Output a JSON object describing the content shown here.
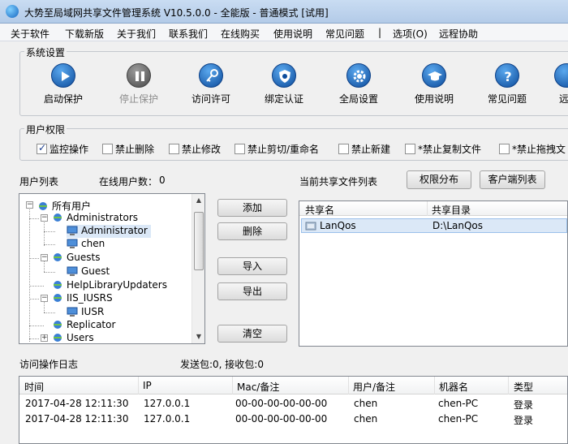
{
  "window": {
    "title": "大势至局域网共享文件管理系统 V10.5.0.0 - 全能版 - 普通模式 [试用]"
  },
  "menu": [
    "关于软件",
    "下载新版",
    "关于我们",
    "联系我们",
    "在线购买",
    "使用说明",
    "常见问题",
    "|",
    "选项(O)",
    "远程协助"
  ],
  "system_settings": {
    "label": "系统设置",
    "buttons": [
      {
        "label": "启动保护",
        "icon": "play-icon",
        "enabled": true
      },
      {
        "label": "停止保护",
        "icon": "pause-icon",
        "enabled": false
      },
      {
        "label": "访问许可",
        "icon": "key-icon",
        "enabled": true
      },
      {
        "label": "绑定认证",
        "icon": "shield-icon",
        "enabled": true
      },
      {
        "label": "全局设置",
        "icon": "gear-icon",
        "enabled": true
      },
      {
        "label": "使用说明",
        "icon": "graduation-cap-icon",
        "enabled": true
      },
      {
        "label": "常见问题",
        "icon": "question-icon",
        "enabled": true
      },
      {
        "label": "远",
        "icon": "more-icon",
        "enabled": true
      }
    ]
  },
  "user_permissions": {
    "label": "用户权限",
    "options": [
      {
        "label": "监控操作",
        "checked": true
      },
      {
        "label": "禁止删除",
        "checked": false
      },
      {
        "label": "禁止修改",
        "checked": false
      },
      {
        "label": "禁止剪切/重命名",
        "checked": false
      },
      {
        "label": "禁止新建",
        "checked": false
      },
      {
        "label": "*禁止复制文件",
        "checked": false
      },
      {
        "label": "*禁止拖拽文",
        "checked": false
      }
    ]
  },
  "users": {
    "label": "用户列表",
    "online_label": "在线用户数：",
    "online_count": "0",
    "tree": [
      {
        "label": "所有用户",
        "depth": 0,
        "expander": "−"
      },
      {
        "label": "Administrators",
        "depth": 1,
        "expander": "−"
      },
      {
        "label": "Administrator",
        "depth": 2,
        "expander": "",
        "selected": true
      },
      {
        "label": "chen",
        "depth": 2,
        "expander": ""
      },
      {
        "label": "Guests",
        "depth": 1,
        "expander": "−"
      },
      {
        "label": "Guest",
        "depth": 2,
        "expander": ""
      },
      {
        "label": "HelpLibraryUpdaters",
        "depth": 1,
        "expander": ""
      },
      {
        "label": "IIS_IUSRS",
        "depth": 1,
        "expander": "−"
      },
      {
        "label": "IUSR",
        "depth": 2,
        "expander": ""
      },
      {
        "label": "Replicator",
        "depth": 1,
        "expander": ""
      },
      {
        "label": "Users",
        "depth": 1,
        "expander": "+"
      }
    ]
  },
  "actions": {
    "add": "添加",
    "delete": "删除",
    "import": "导入",
    "export": "导出",
    "clear": "清空"
  },
  "shares": {
    "label": "当前共享文件列表",
    "perm_button": "权限分布",
    "client_button": "客户端列表",
    "columns": [
      "共享名",
      "共享目录"
    ],
    "rows": [
      {
        "name": "LanQos",
        "path": "D:\\LanQos"
      }
    ]
  },
  "log": {
    "label": "访问操作日志",
    "stats": "发送包:0, 接收包:0",
    "columns": [
      "时间",
      "IP",
      "Mac/备注",
      "用户/备注",
      "机器名",
      "类型"
    ],
    "rows": [
      {
        "time": "2017-04-28 12:11:30",
        "ip": "127.0.0.1",
        "mac": "00-00-00-00-00-00",
        "user": "chen",
        "machine": "chen-PC",
        "type": "登录"
      },
      {
        "time": "2017-04-28 12:11:30",
        "ip": "127.0.0.1",
        "mac": "00-00-00-00-00-00",
        "user": "chen",
        "machine": "chen-PC",
        "type": "登录"
      }
    ]
  }
}
